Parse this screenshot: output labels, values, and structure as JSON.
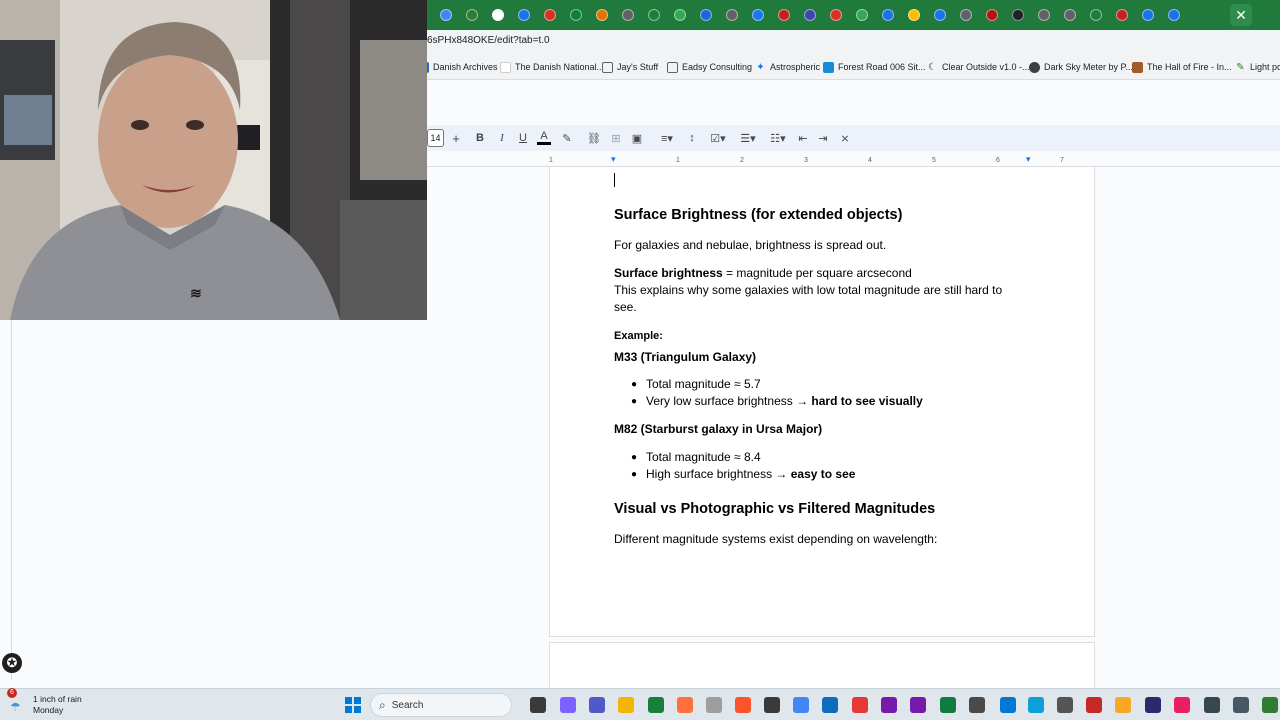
{
  "browser": {
    "url_fragment": "6sPHx848OKE/edit?tab=t.0",
    "close_label": "✕",
    "bookmarks": [
      {
        "label": "Danish Archives",
        "color": "#2a66c8"
      },
      {
        "label": "The Danish National...",
        "color": "#ffffff"
      },
      {
        "label": "Jay's Stuff",
        "color": "#5f6368"
      },
      {
        "label": "Eadsy Consulting",
        "color": "#5f6368"
      },
      {
        "label": "Astrospheric",
        "color": "#1a73e8"
      },
      {
        "label": "Forest Road 006 Sit...",
        "color": "#1a8bd8"
      },
      {
        "label": "Clear Outside v1.0 -...",
        "color": "#5f6368"
      },
      {
        "label": "Dark Sky Meter by P...",
        "color": "#3c4043"
      },
      {
        "label": "The Hall of Fire - In...",
        "color": "#a35b2a"
      },
      {
        "label": "Light pol",
        "color": "#2e7d32"
      }
    ]
  },
  "toolbar": {
    "font_size": "14",
    "plus": "+",
    "bold": "B",
    "italic": "I",
    "underline": "U",
    "text_color": "A"
  },
  "ruler": {
    "ticks": [
      "1",
      "1",
      "2",
      "3",
      "4",
      "5",
      "6",
      "7"
    ]
  },
  "document": {
    "heading1": "Surface Brightness (for extended objects)",
    "para1": "For galaxies and nebulae, brightness is spread out.",
    "para2_bold": "Surface brightness",
    "para2_rest": " = magnitude per square arcsecond",
    "para3_line1": " This explains why some galaxies with low total magnitude are still hard to",
    "para3_line2": "see.",
    "example_label": "Example:",
    "m33_title": "M33 (Triangulum Galaxy)",
    "m33_bullets": [
      {
        "text": "Total magnitude ≈ 5.7",
        "bold": ""
      },
      {
        "text": "Very low surface brightness → ",
        "bold": "hard to see visually"
      }
    ],
    "m82_title": "M82 (Starburst galaxy in Ursa Major)",
    "m82_bullets": [
      {
        "text": "Total magnitude ≈ 8.4",
        "bold": ""
      },
      {
        "text": "High surface brightness → ",
        "bold": "easy to see"
      }
    ],
    "heading2": "Visual vs Photographic vs Filtered Magnitudes",
    "para4": "Different magnitude systems exist depending on wavelength:"
  },
  "taskbar": {
    "weather_badge": "6",
    "weather_line1": "1 inch of rain",
    "weather_line2": "Monday",
    "search_label": "Search"
  },
  "colors": {
    "chrome_tab_strip": "#1f7a3c",
    "taskbar": "#dfe6ec",
    "accent": "#1a73e8"
  }
}
